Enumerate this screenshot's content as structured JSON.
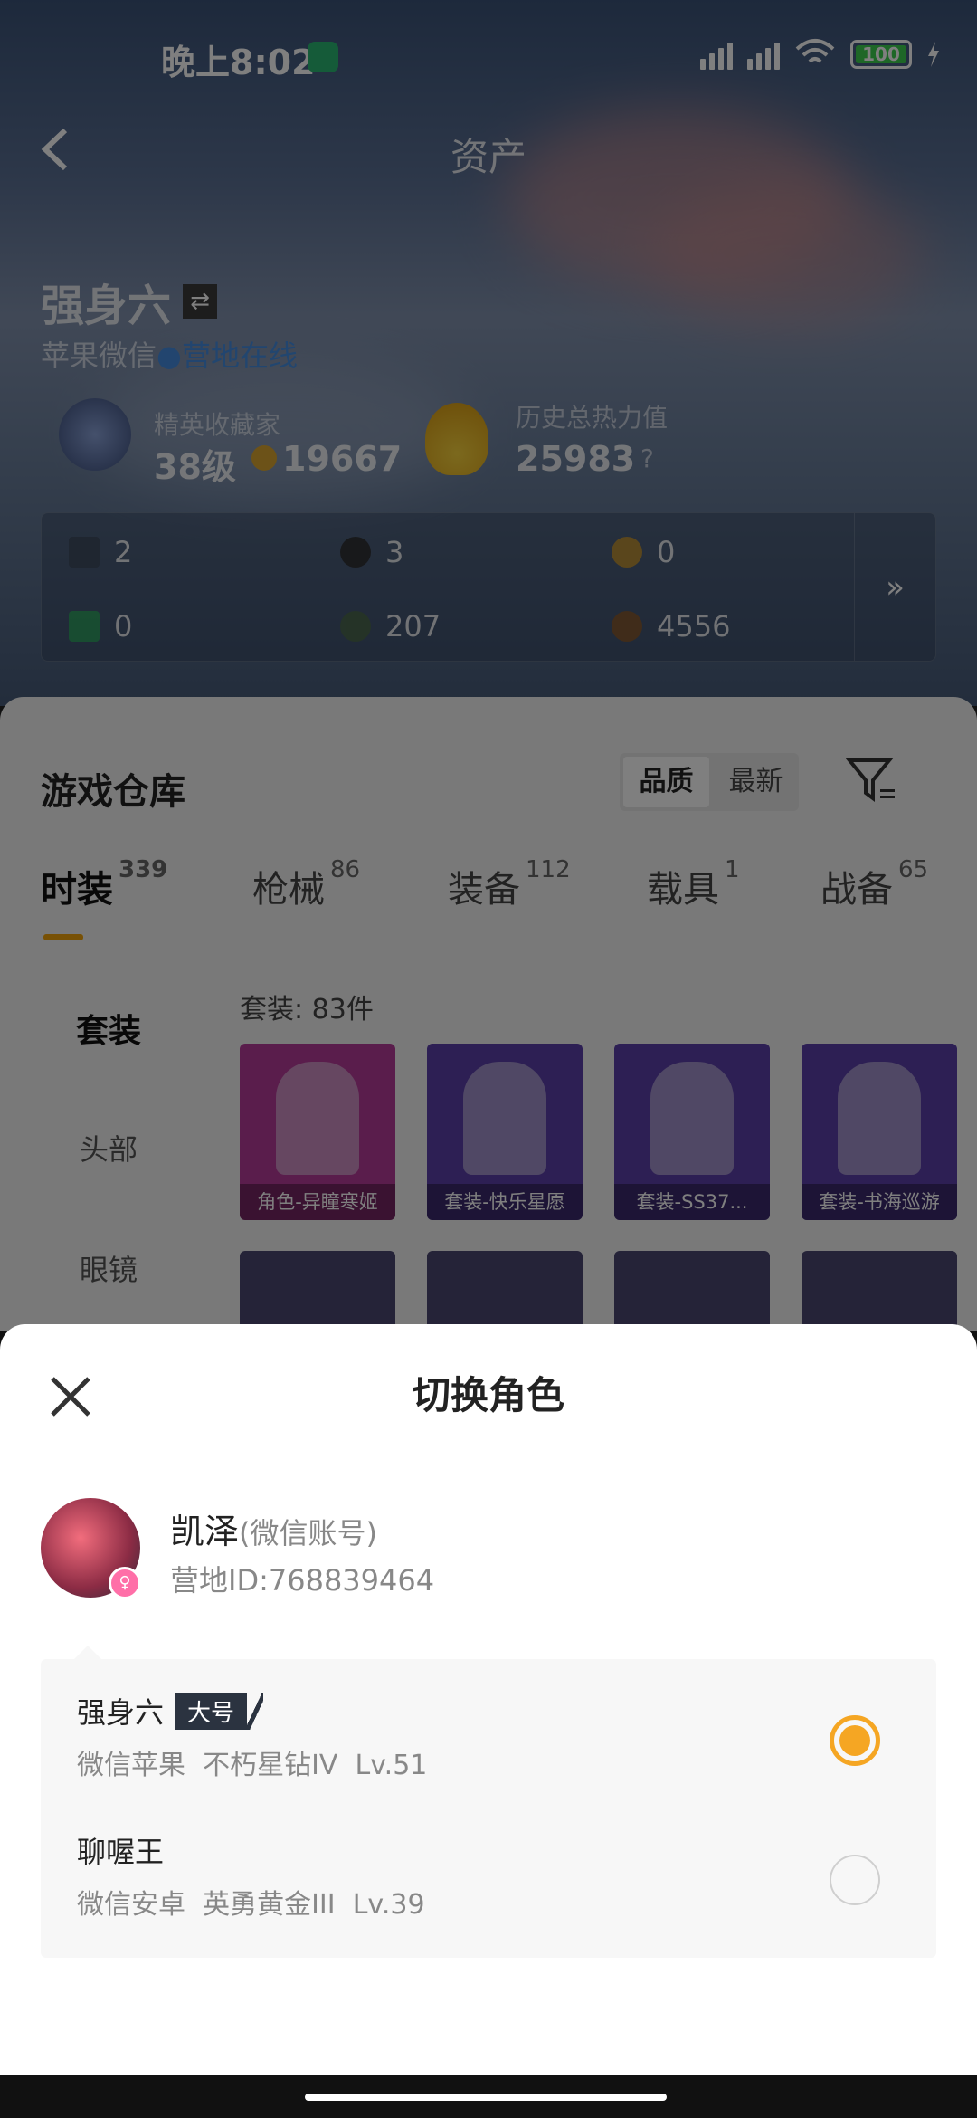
{
  "status_bar": {
    "time": "晚上8:02",
    "signal1": "HD",
    "signal2": "HD",
    "battery": "100"
  },
  "header": {
    "title": "资产"
  },
  "profile": {
    "name": "强身六",
    "platform": "苹果微信",
    "online_dot": "●",
    "online_text": "营地在线",
    "collector_label": "精英收藏家",
    "collector_level": "38级",
    "collector_points": "19667",
    "heat_label": "历史总热力值",
    "heat_value": "25983",
    "heat_help": "?"
  },
  "assets": {
    "items": [
      {
        "value": "2",
        "icon": "card-icon",
        "color": "#3d4a5d"
      },
      {
        "value": "3",
        "icon": "coin-dark-icon",
        "color": "#2c2c2c"
      },
      {
        "value": "0",
        "icon": "coin-gold-icon",
        "color": "#c8962e"
      },
      {
        "value": "0",
        "icon": "ticket-green-icon",
        "color": "#2fa660"
      },
      {
        "value": "207",
        "icon": "coin-green-icon",
        "color": "#4c6a4a"
      },
      {
        "value": "4556",
        "icon": "coin-bronze-icon",
        "color": "#8b5a2b"
      }
    ],
    "more": "»"
  },
  "warehouse": {
    "title": "游戏仓库",
    "sort_quality": "品质",
    "sort_latest": "最新",
    "tabs": [
      {
        "label": "时装",
        "count": "339"
      },
      {
        "label": "枪械",
        "count": "86"
      },
      {
        "label": "装备",
        "count": "112"
      },
      {
        "label": "载具",
        "count": "1"
      },
      {
        "label": "战备",
        "count": "65"
      }
    ],
    "side_items": [
      "套装",
      "头部",
      "眼镜"
    ],
    "count_text": "套装: 83件",
    "cards": [
      {
        "label": "角色-异瞳寒姬",
        "color": "#b43a98"
      },
      {
        "label": "套装-快乐星愿",
        "color": "#5a3fa8"
      },
      {
        "label": "套装-SS37...",
        "color": "#5a3fa8"
      },
      {
        "label": "套装-书海巡游",
        "color": "#5a3fa8"
      }
    ]
  },
  "sheet": {
    "title": "切换角色",
    "account_name": "凯泽",
    "account_type": "(微信账号)",
    "account_id": "营地ID:768839464",
    "roles": [
      {
        "name": "强身六",
        "tag": "大号",
        "platform": "微信苹果",
        "rank": "不朽星钻IV",
        "level": "Lv.51",
        "selected": true
      },
      {
        "name": "聊喔王",
        "tag": "",
        "platform": "微信安卓",
        "rank": "英勇黄金III",
        "level": "Lv.39",
        "selected": false
      }
    ]
  }
}
